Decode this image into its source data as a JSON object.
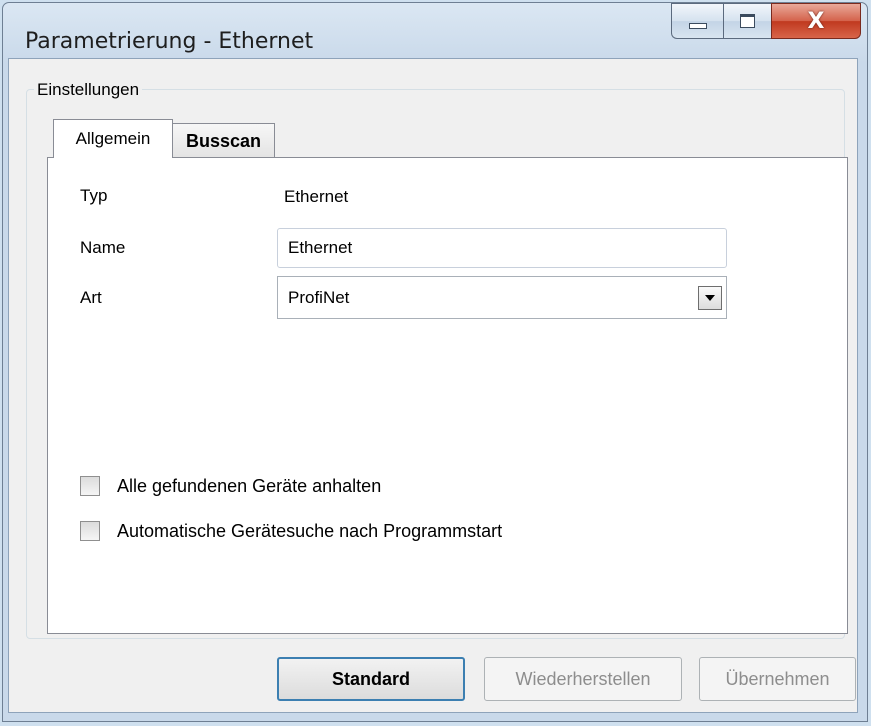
{
  "window": {
    "title": "Parametrierung - Ethernet",
    "close_glyph": "X"
  },
  "group": {
    "label": "Einstellungen"
  },
  "tabs": [
    {
      "label": "Allgemein",
      "active": true
    },
    {
      "label": "Busscan",
      "active": false
    }
  ],
  "form": {
    "typ_label": "Typ",
    "typ_value": "Ethernet",
    "name_label": "Name",
    "name_value": "Ethernet",
    "art_label": "Art",
    "art_value": "ProfiNet"
  },
  "checkboxes": [
    {
      "label": "Alle gefundenen Geräte anhalten",
      "checked": false
    },
    {
      "label": "Automatische Gerätesuche nach Programmstart",
      "checked": false
    }
  ],
  "buttons": {
    "standard": "Standard",
    "restore": "Wiederherstellen",
    "apply": "Übernehmen"
  },
  "colors": {
    "titlebar": "#c9d9ea",
    "close_button": "#c0391f",
    "default_button_border": "#3c7fb1"
  }
}
